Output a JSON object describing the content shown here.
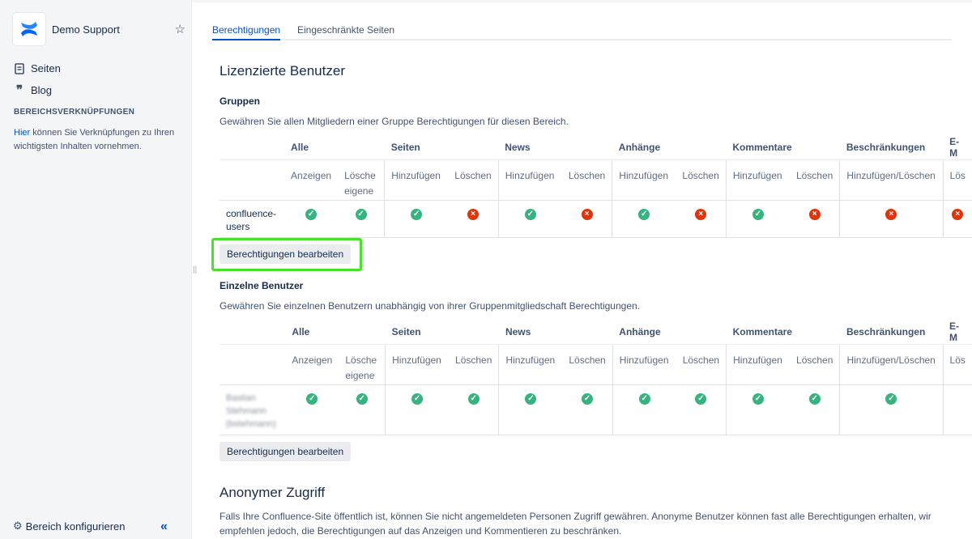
{
  "sidebar": {
    "space_name": "Demo Support",
    "nav": [
      {
        "label": "Seiten",
        "icon": "page-icon"
      },
      {
        "label": "Blog",
        "icon": "quote-icon"
      }
    ],
    "section_title": "BEREICHSVERKNÜPFUNGEN",
    "shortcut_link": "Hier",
    "shortcut_text": " können Sie Verknüpfungen zu Ihren wichtigsten Inhalten vornehmen.",
    "footer_label": "Bereich konfigurieren"
  },
  "tabs": [
    {
      "label": "Berechtigungen",
      "active": true
    },
    {
      "label": "Eingeschränkte Seiten",
      "active": false
    }
  ],
  "licensed": {
    "title": "Lizenzierte Benutzer",
    "groups_title": "Gruppen",
    "groups_desc": "Gewähren Sie allen Mitgliedern einer Gruppe Berechtigungen für diesen Bereich.",
    "users_title": "Einzelne Benutzer",
    "users_desc": "Gewähren Sie einzelnen Benutzern unabhängig von ihrer Gruppenmitgliedschaft Berechtigungen."
  },
  "table_headers": {
    "categories": [
      "Alle",
      "Seiten",
      "News",
      "Anhänge",
      "Kommentare",
      "Beschränkungen",
      "E-M"
    ],
    "sub": [
      "Anzeigen",
      "Lösche eigene",
      "Hinzufügen",
      "Löschen",
      "Hinzufügen",
      "Löschen",
      "Hinzufügen",
      "Löschen",
      "Hinzufügen",
      "Löschen",
      "Hinzufügen/Löschen",
      "Lös"
    ]
  },
  "groups_row": {
    "name_line1": "confluence-",
    "name_line2": "users",
    "perms": [
      "ok",
      "ok",
      "ok",
      "no",
      "ok",
      "no",
      "ok",
      "no",
      "ok",
      "no",
      "no",
      "no"
    ]
  },
  "users_row": {
    "name_line1": "Bastian",
    "name_line2": "Stehmann",
    "name_line3": "(bstehmann)",
    "perms": [
      "ok",
      "ok",
      "ok",
      "ok",
      "ok",
      "ok",
      "ok",
      "ok",
      "ok",
      "ok",
      "ok",
      ""
    ]
  },
  "edit_button": "Berechtigungen bearbeiten",
  "anonymous": {
    "title": "Anonymer Zugriff",
    "text": "Falls Ihre Confluence-Site öffentlich ist, können Sie nicht angemeldeten Personen Zugriff gewähren. Anonyme Benutzer können fast alle Berechtigungen erhalten, wir empfehlen jedoch, die Berechtigungen auf das Anzeigen und Kommentieren zu beschränken."
  },
  "colors": {
    "accent": "#0052cc",
    "ok": "#36b37e",
    "no": "#de350b",
    "highlight": "#48e22c"
  }
}
